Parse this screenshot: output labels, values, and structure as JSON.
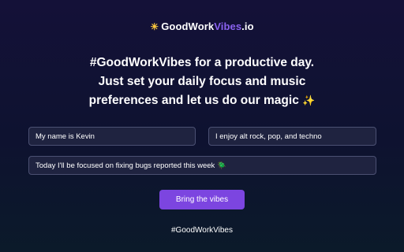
{
  "brand": {
    "icon": "sun-icon",
    "name_part1": "GoodWork",
    "name_part2": "Vibes",
    "name_part3": ".io",
    "accent_color": "#8a62f0"
  },
  "headline": {
    "line1": "#GoodWorkVibes for a productive day.",
    "line2": "Just set your daily focus and music",
    "line3": "preferences and let us do our magic",
    "sparkle_icon": "sparkles-icon"
  },
  "form": {
    "name_placeholder": "My name is Kevin",
    "music_placeholder": "I enjoy alt rock, pop, and techno",
    "focus_placeholder": "Today I'll be focused on fixing bugs reported this week 🪲",
    "submit_label": "Bring the vibes",
    "button_color": "#7c45e0"
  },
  "footer": {
    "hashtag": "#GoodWorkVibes"
  }
}
